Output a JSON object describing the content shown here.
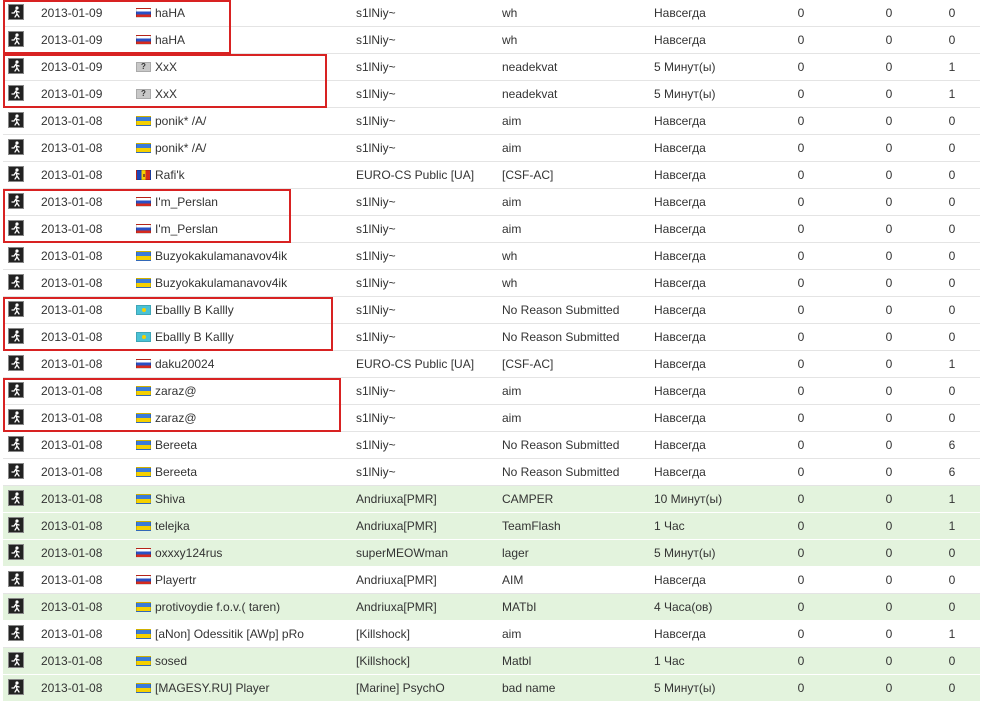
{
  "colors": {
    "active_row": "#e3f3dd",
    "highlight_box": "#d82222",
    "row_text": "#333333"
  },
  "bans": {
    "rows": [
      {
        "date": "2013-01-09",
        "flag": "ru",
        "name": "haHA",
        "admin": "s1lNiy~",
        "reason": "wh",
        "length": "Навсегда",
        "n1": "0",
        "n2": "0",
        "n3": "0",
        "active": false
      },
      {
        "date": "2013-01-09",
        "flag": "ru",
        "name": "haHA",
        "admin": "s1lNiy~",
        "reason": "wh",
        "length": "Навсегда",
        "n1": "0",
        "n2": "0",
        "n3": "0",
        "active": false
      },
      {
        "date": "2013-01-09",
        "flag": "unknown",
        "flag_symbol": "?",
        "name": "XxX",
        "admin": "s1lNiy~",
        "reason": "neadekvat",
        "length": "5 Минут(ы)",
        "n1": "0",
        "n2": "0",
        "n3": "1",
        "active": false
      },
      {
        "date": "2013-01-09",
        "flag": "unknown",
        "flag_symbol": "?",
        "name": "XxX",
        "admin": "s1lNiy~",
        "reason": "neadekvat",
        "length": "5 Минут(ы)",
        "n1": "0",
        "n2": "0",
        "n3": "1",
        "active": false
      },
      {
        "date": "2013-01-08",
        "flag": "ua",
        "name": "ponik* /A/",
        "admin": "s1lNiy~",
        "reason": "aim",
        "length": "Навсегда",
        "n1": "0",
        "n2": "0",
        "n3": "0",
        "active": false
      },
      {
        "date": "2013-01-08",
        "flag": "ua",
        "name": "ponik* /A/",
        "admin": "s1lNiy~",
        "reason": "aim",
        "length": "Навсегда",
        "n1": "0",
        "n2": "0",
        "n3": "0",
        "active": false
      },
      {
        "date": "2013-01-08",
        "flag": "md",
        "name": "Rafi'k",
        "admin": "EURO-CS Public [UA]",
        "reason": "[CSF-AC]",
        "length": "Навсегда",
        "n1": "0",
        "n2": "0",
        "n3": "0",
        "active": false
      },
      {
        "date": "2013-01-08",
        "flag": "ru",
        "name": "I'm_Perslan",
        "admin": "s1lNiy~",
        "reason": "aim",
        "length": "Навсегда",
        "n1": "0",
        "n2": "0",
        "n3": "0",
        "active": false
      },
      {
        "date": "2013-01-08",
        "flag": "ru",
        "name": "I'm_Perslan",
        "admin": "s1lNiy~",
        "reason": "aim",
        "length": "Навсегда",
        "n1": "0",
        "n2": "0",
        "n3": "0",
        "active": false
      },
      {
        "date": "2013-01-08",
        "flag": "ua",
        "name": "Buzyokakulamanavov4ik",
        "admin": "s1lNiy~",
        "reason": "wh",
        "length": "Навсегда",
        "n1": "0",
        "n2": "0",
        "n3": "0",
        "active": false
      },
      {
        "date": "2013-01-08",
        "flag": "ua",
        "name": "Buzyokakulamanavov4ik",
        "admin": "s1lNiy~",
        "reason": "wh",
        "length": "Навсегда",
        "n1": "0",
        "n2": "0",
        "n3": "0",
        "active": false
      },
      {
        "date": "2013-01-08",
        "flag": "kz",
        "name": "Eballly B Kallly",
        "admin": "s1lNiy~",
        "reason": "No Reason Submitted",
        "length": "Навсегда",
        "n1": "0",
        "n2": "0",
        "n3": "0",
        "active": false
      },
      {
        "date": "2013-01-08",
        "flag": "kz",
        "name": "Eballly B Kallly",
        "admin": "s1lNiy~",
        "reason": "No Reason Submitted",
        "length": "Навсегда",
        "n1": "0",
        "n2": "0",
        "n3": "0",
        "active": false
      },
      {
        "date": "2013-01-08",
        "flag": "ru",
        "name": "daku20024",
        "admin": "EURO-CS Public [UA]",
        "reason": "[CSF-AC]",
        "length": "Навсегда",
        "n1": "0",
        "n2": "0",
        "n3": "1",
        "active": false
      },
      {
        "date": "2013-01-08",
        "flag": "ua",
        "name": "zaraz@",
        "admin": "s1lNiy~",
        "reason": "aim",
        "length": "Навсегда",
        "n1": "0",
        "n2": "0",
        "n3": "0",
        "active": false
      },
      {
        "date": "2013-01-08",
        "flag": "ua",
        "name": "zaraz@",
        "admin": "s1lNiy~",
        "reason": "aim",
        "length": "Навсегда",
        "n1": "0",
        "n2": "0",
        "n3": "0",
        "active": false
      },
      {
        "date": "2013-01-08",
        "flag": "ua",
        "name": "Bereeta",
        "admin": "s1lNiy~",
        "reason": "No Reason Submitted",
        "length": "Навсегда",
        "n1": "0",
        "n2": "0",
        "n3": "6",
        "active": false
      },
      {
        "date": "2013-01-08",
        "flag": "ua",
        "name": "Bereeta",
        "admin": "s1lNiy~",
        "reason": "No Reason Submitted",
        "length": "Навсегда",
        "n1": "0",
        "n2": "0",
        "n3": "6",
        "active": false
      },
      {
        "date": "2013-01-08",
        "flag": "ua",
        "name": "Shiva",
        "admin": "Andriuxa[PMR]",
        "reason": "CAMPER",
        "length": "10 Минут(ы)",
        "n1": "0",
        "n2": "0",
        "n3": "1",
        "active": true
      },
      {
        "date": "2013-01-08",
        "flag": "ua",
        "name": "telejka",
        "admin": "Andriuxa[PMR]",
        "reason": "TeamFlash",
        "length": "1 Час",
        "n1": "0",
        "n2": "0",
        "n3": "1",
        "active": true
      },
      {
        "date": "2013-01-08",
        "flag": "ru",
        "name": "oxxxy124rus",
        "admin": "superMEOWman",
        "reason": "lager",
        "length": "5 Минут(ы)",
        "n1": "0",
        "n2": "0",
        "n3": "0",
        "active": true
      },
      {
        "date": "2013-01-08",
        "flag": "ru",
        "name": "Playertr",
        "admin": "Andriuxa[PMR]",
        "reason": "AIM",
        "length": "Навсегда",
        "n1": "0",
        "n2": "0",
        "n3": "0",
        "active": false
      },
      {
        "date": "2013-01-08",
        "flag": "ua",
        "name": "protivoydie f.o.v.( taren)",
        "admin": "Andriuxa[PMR]",
        "reason": "MATbI",
        "length": "4 Часа(ов)",
        "n1": "0",
        "n2": "0",
        "n3": "0",
        "active": true
      },
      {
        "date": "2013-01-08",
        "flag": "ua",
        "name": "[aNon] Odessitik [AWp] pRo",
        "admin": "[Killshock]",
        "reason": "aim",
        "length": "Навсегда",
        "n1": "0",
        "n2": "0",
        "n3": "1",
        "active": false
      },
      {
        "date": "2013-01-08",
        "flag": "ua",
        "name": "sosed",
        "admin": "[Killshock]",
        "reason": "Matbl",
        "length": "1 Час",
        "n1": "0",
        "n2": "0",
        "n3": "0",
        "active": true
      },
      {
        "date": "2013-01-08",
        "flag": "ua",
        "name": "[MAGESY.RU] Player",
        "admin": "[Marine] PsychO",
        "reason": "bad name",
        "length": "5 Минут(ы)",
        "n1": "0",
        "n2": "0",
        "n3": "0",
        "active": true
      }
    ],
    "highlight_groups": [
      {
        "first_row": 0,
        "last_row": 1
      },
      {
        "first_row": 2,
        "last_row": 3
      },
      {
        "first_row": 7,
        "last_row": 8
      },
      {
        "first_row": 11,
        "last_row": 12
      },
      {
        "first_row": 14,
        "last_row": 15
      }
    ]
  }
}
